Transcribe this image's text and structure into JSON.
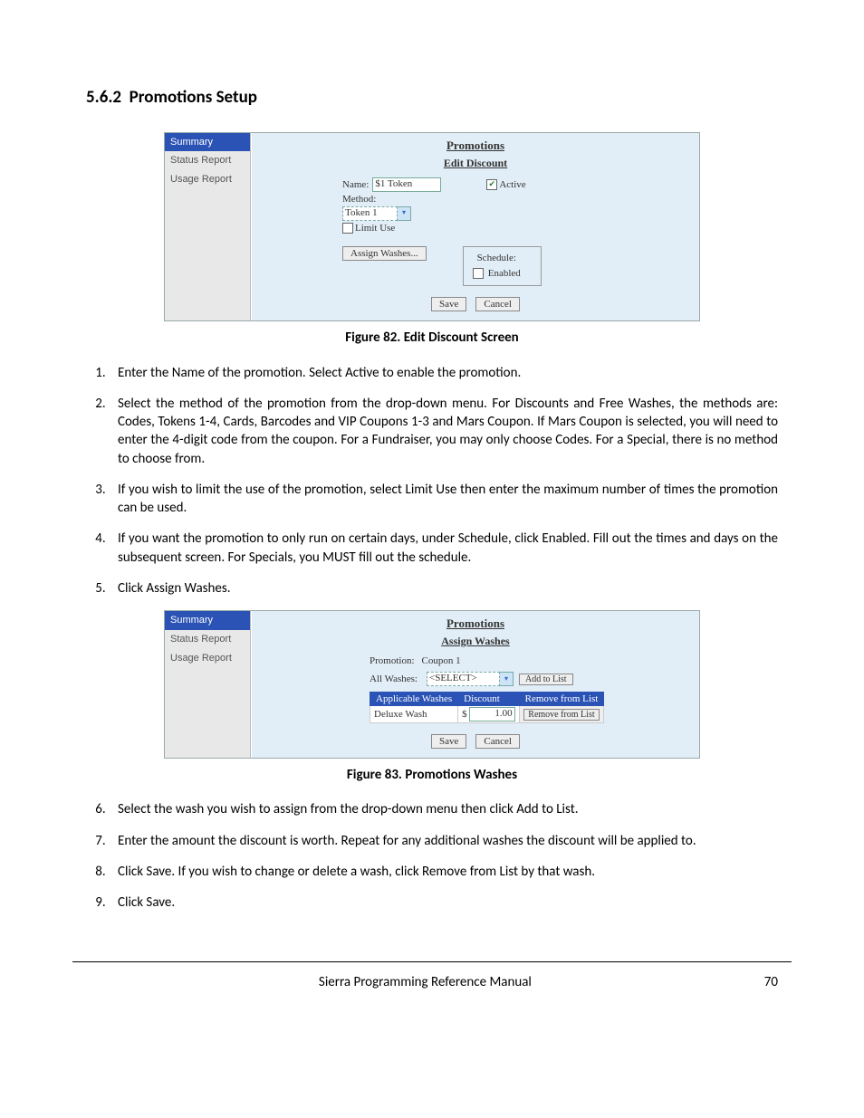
{
  "section": {
    "number": "5.6.2",
    "title": "Promotions Setup"
  },
  "figure82_caption": "Figure 82. Edit Discount Screen",
  "figure83_caption": "Figure 83. Promotions Washes",
  "steps_a": [
    "Enter the Name of the promotion. Select Active to enable the promotion.",
    "Select the method of the promotion from the drop-down menu. For Discounts and Free Washes, the methods are: Codes, Tokens 1-4, Cards, Barcodes and VIP Coupons 1-3 and Mars Coupon. If Mars Coupon is selected, you will need to enter the 4-digit code from the coupon. For a Fundraiser, you may only choose Codes. For a Special, there is no method to choose from.",
    "If you wish to limit the use of the promotion, select Limit Use then enter the maximum number of times the promotion can be used.",
    "If you want the promotion to only run on certain days, under Schedule, click Enabled. Fill out the times and days on the subsequent screen. For Specials, you MUST fill out the schedule.",
    "Click Assign Washes."
  ],
  "steps_b": [
    "Select the wash you wish to assign from the drop-down menu then click Add to List.",
    "Enter the amount the discount is worth. Repeat for any additional washes the discount will be applied to.",
    "Click Save. If you wish to change or delete a wash, click Remove from List by that wash.",
    "Click Save."
  ],
  "app1": {
    "sidebar": [
      "Summary",
      "Status Report",
      "Usage Report"
    ],
    "title": "Promotions",
    "subtitle": "Edit Discount",
    "name_label": "Name:",
    "name_value": "$1 Token",
    "active_label": "Active",
    "method_label": "Method:",
    "method_value": "Token 1",
    "limit_label": "Limit Use",
    "assign_btn": "Assign Washes...",
    "schedule_label": "Schedule:",
    "enabled_label": "Enabled",
    "save": "Save",
    "cancel": "Cancel"
  },
  "app2": {
    "sidebar": [
      "Summary",
      "Status Report",
      "Usage Report"
    ],
    "title": "Promotions",
    "subtitle": "Assign Washes",
    "promotion_label": "Promotion:",
    "promotion_value": "Coupon 1",
    "allwashes_label": "All Washes:",
    "allwashes_value": "<SELECT>",
    "addtolist": "Add to List",
    "th1": "Applicable Washes",
    "th2": "Discount",
    "th3": "Remove from List",
    "row_wash": "Deluxe Wash",
    "row_currency": "$",
    "row_amount": "1.00",
    "row_remove": "Remove from List",
    "save": "Save",
    "cancel": "Cancel"
  },
  "footer": {
    "manual": "Sierra Programming Reference Manual",
    "page": "70"
  }
}
